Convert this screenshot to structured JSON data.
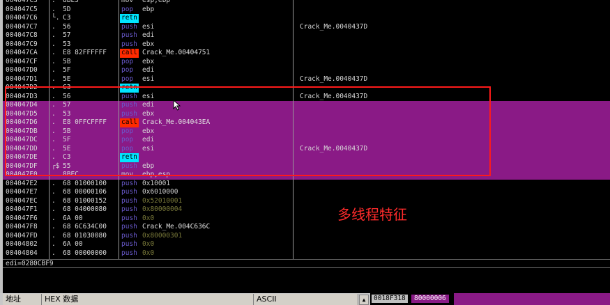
{
  "rows": [
    {
      "addr": "004047C3",
      "dot": ".",
      "hex": "8BE5",
      "mn": "mov",
      "mnc": "mn-mov",
      "op": "esp,ebp",
      "opc": "",
      "cm": "",
      "hl": false
    },
    {
      "addr": "004047C5",
      "dot": ".",
      "hex": "5D",
      "mn": "pop",
      "mnc": "mn-pop",
      "op": "ebp",
      "opc": "",
      "cm": "",
      "hl": false
    },
    {
      "addr": "004047C6",
      "dot": "└.",
      "hex": "C3",
      "mn": "retn",
      "mnc": "mn-retn",
      "op": "",
      "opc": "",
      "cm": "",
      "hl": false
    },
    {
      "addr": "004047C7",
      "dot": ".",
      "hex": "56",
      "mn": "push",
      "mnc": "mn-push",
      "op": "esi",
      "opc": "",
      "cm": "Crack_Me.0040437D",
      "hl": false
    },
    {
      "addr": "004047C8",
      "dot": ".",
      "hex": "57",
      "mn": "push",
      "mnc": "mn-push",
      "op": "edi",
      "opc": "",
      "cm": "",
      "hl": false
    },
    {
      "addr": "004047C9",
      "dot": ".",
      "hex": "53",
      "mn": "push",
      "mnc": "mn-push",
      "op": "ebx",
      "opc": "",
      "cm": "",
      "hl": false
    },
    {
      "addr": "004047CA",
      "dot": ".",
      "hex": "E8 82FFFFFF",
      "mn": "call",
      "mnc": "mn-call",
      "op": "Crack_Me.00404751",
      "opc": "op-call",
      "cm": "",
      "hl": false
    },
    {
      "addr": "004047CF",
      "dot": ".",
      "hex": "5B",
      "mn": "pop",
      "mnc": "mn-pop",
      "op": "ebx",
      "opc": "",
      "cm": "",
      "hl": false
    },
    {
      "addr": "004047D0",
      "dot": ".",
      "hex": "5F",
      "mn": "pop",
      "mnc": "mn-pop",
      "op": "edi",
      "opc": "",
      "cm": "",
      "hl": false
    },
    {
      "addr": "004047D1",
      "dot": ".",
      "hex": "5E",
      "mn": "pop",
      "mnc": "mn-pop",
      "op": "esi",
      "opc": "",
      "cm": "Crack_Me.0040437D",
      "hl": false
    },
    {
      "addr": "004047D2",
      "dot": ".",
      "hex": "C3",
      "mn": "retn",
      "mnc": "mn-retn",
      "op": "",
      "opc": "",
      "cm": "",
      "hl": false
    },
    {
      "addr": "004047D3",
      "dot": ".",
      "hex": "56",
      "mn": "push",
      "mnc": "mn-push",
      "op": "esi",
      "opc": "",
      "cm": "Crack_Me.0040437D",
      "hl": false
    },
    {
      "addr": "004047D4",
      "dot": ".",
      "hex": "57",
      "mn": "push",
      "mnc": "mn-push",
      "op": "edi",
      "opc": "",
      "cm": "",
      "hl": true
    },
    {
      "addr": "004047D5",
      "dot": ".",
      "hex": "53",
      "mn": "push",
      "mnc": "mn-push",
      "op": "ebx",
      "opc": "",
      "cm": "",
      "hl": true
    },
    {
      "addr": "004047D6",
      "dot": ".",
      "hex": "E8 0FFCFFFF",
      "mn": "call",
      "mnc": "mn-call",
      "op": "Crack_Me.004043EA",
      "opc": "op-call",
      "cm": "",
      "hl": true
    },
    {
      "addr": "004047DB",
      "dot": ".",
      "hex": "5B",
      "mn": "pop",
      "mnc": "mn-pop",
      "op": "ebx",
      "opc": "",
      "cm": "",
      "hl": true
    },
    {
      "addr": "004047DC",
      "dot": ".",
      "hex": "5F",
      "mn": "pop",
      "mnc": "mn-pop",
      "op": "edi",
      "opc": "",
      "cm": "",
      "hl": true
    },
    {
      "addr": "004047DD",
      "dot": ".",
      "hex": "5E",
      "mn": "pop",
      "mnc": "mn-pop",
      "op": "esi",
      "opc": "",
      "cm": "Crack_Me.0040437D",
      "hl": true
    },
    {
      "addr": "004047DE",
      "dot": ".",
      "hex": "C3",
      "mn": "retn",
      "mnc": "mn-retn",
      "op": "",
      "opc": "",
      "cm": "",
      "hl": true
    },
    {
      "addr": "004047DF",
      "dot": "┌$",
      "hex": "55",
      "mn": "push",
      "mnc": "mn-push",
      "op": "ebp",
      "opc": "",
      "cm": "",
      "hl": true
    },
    {
      "addr": "004047E0",
      "dot": ".",
      "hex": "8BEC",
      "mn": "mov",
      "mnc": "mn-mov",
      "op": "ebp,esp",
      "opc": "",
      "cm": "",
      "hl": true
    },
    {
      "addr": "004047E2",
      "dot": ".",
      "hex": "68 01000100",
      "mn": "push",
      "mnc": "mn-push",
      "op": "0x10001",
      "opc": "op-num",
      "cm": "",
      "hl": false
    },
    {
      "addr": "004047E7",
      "dot": ".",
      "hex": "68 00000106",
      "mn": "push",
      "mnc": "mn-push",
      "op": "0x6010000",
      "opc": "op-num",
      "cm": "",
      "hl": false
    },
    {
      "addr": "004047EC",
      "dot": ".",
      "hex": "68 01000152",
      "mn": "push",
      "mnc": "mn-push",
      "op": "0x52010001",
      "opc": "op-dim",
      "cm": "",
      "hl": false
    },
    {
      "addr": "004047F1",
      "dot": ".",
      "hex": "68 04000080",
      "mn": "push",
      "mnc": "mn-push",
      "op": "0x80000004",
      "opc": "op-dim",
      "cm": "",
      "hl": false
    },
    {
      "addr": "004047F6",
      "dot": ".",
      "hex": "6A 00",
      "mn": "push",
      "mnc": "mn-push",
      "op": "0x0",
      "opc": "op-dim",
      "cm": "",
      "hl": false
    },
    {
      "addr": "004047F8",
      "dot": ".",
      "hex": "68 6C634C00",
      "mn": "push",
      "mnc": "mn-push",
      "op": "Crack_Me.004C636C",
      "opc": "op-call",
      "cm": "",
      "hl": false
    },
    {
      "addr": "004047FD",
      "dot": ".",
      "hex": "68 01030080",
      "mn": "push",
      "mnc": "mn-push",
      "op": "0x80000301",
      "opc": "op-dim",
      "cm": "",
      "hl": false
    },
    {
      "addr": "00404802",
      "dot": ".",
      "hex": "6A 00",
      "mn": "push",
      "mnc": "mn-push",
      "op": "0x0",
      "opc": "op-dim",
      "cm": "",
      "hl": false
    },
    {
      "addr": "00404804",
      "dot": ".",
      "hex": "68 00000000",
      "mn": "push",
      "mnc": "mn-push",
      "op": "0x0",
      "opc": "op-dim",
      "cm": "",
      "hl": false
    }
  ],
  "status_text": "edi=0280CBF9",
  "annotation": "多线程特征",
  "dump_headers": {
    "addr": "地址",
    "hex": "HEX 数据",
    "ascii": "ASCII"
  },
  "stack": {
    "addr": "0018F318",
    "value": "80000006"
  },
  "colors": {
    "highlight": "#8a1a86",
    "call": "#ff2a00",
    "retn": "#00e5ff",
    "annotation": "#ff2b2b"
  },
  "icons": {
    "cursor": "arrow-cursor-icon",
    "scroll": "scroll-arrow-icon"
  }
}
